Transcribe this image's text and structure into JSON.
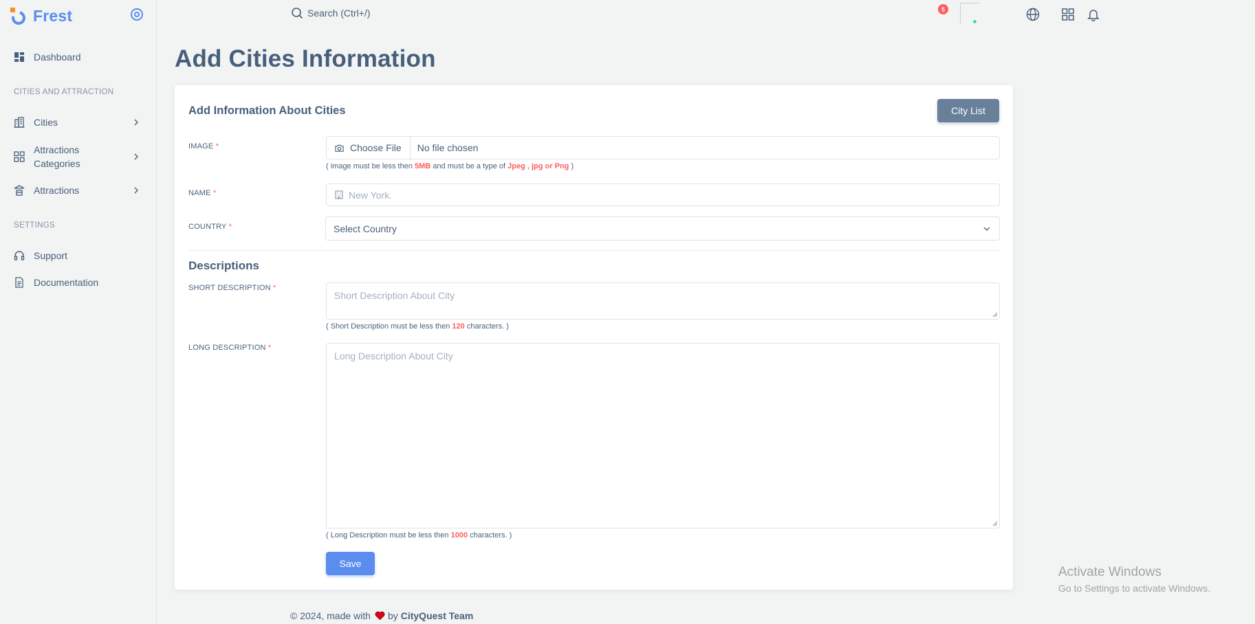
{
  "brand": {
    "name": "Frest"
  },
  "sidebar": {
    "dashboard": "Dashboard",
    "section_cities": "CITIES AND ATTRACTION",
    "cities": "Cities",
    "attr_categories_1": "Attractions",
    "attr_categories_2": "Categories",
    "attractions": "Attractions",
    "section_settings": "SETTINGS",
    "support": "Support",
    "documentation": "Documentation"
  },
  "topbar": {
    "search_placeholder": "Search (Ctrl+/)",
    "notification_count": "5"
  },
  "page": {
    "title": "Add Cities Information"
  },
  "card": {
    "title": "Add Information About Cities",
    "city_list_button": "City List"
  },
  "form": {
    "image_label": "IMAGE",
    "required_mark": "*",
    "choose_file": "Choose File",
    "file_status": "No file chosen",
    "image_hint_pre": "( image must be less then ",
    "image_hint_size": "5MB",
    "image_hint_mid": " and must be a type of ",
    "image_hint_types": "Jpeg , jpg or Png",
    "image_hint_post": " )",
    "name_label": "NAME",
    "name_placeholder": "New York.",
    "country_label": "COUNTRY",
    "country_value": "Select Country",
    "descriptions_title": "Descriptions",
    "short_label": "SHORT DESCRIPTION",
    "short_placeholder": "Short Description About City",
    "short_hint_pre": "( Short Description must be less then ",
    "short_hint_count": "120",
    "short_hint_post": " characters. )",
    "long_label": "LONG DESCRIPTION",
    "long_placeholder": "Long Description About City",
    "long_hint_pre": "( Long Description must be less then ",
    "long_hint_count": "1000",
    "long_hint_post": " characters. )",
    "save_button": "Save"
  },
  "footer": {
    "copyright": "© 2024, made with",
    "by": "by",
    "team": "CityQuest Team"
  },
  "watermark": {
    "line1": "Activate Windows",
    "line2": "Go to Settings to activate Windows."
  },
  "colors": {
    "primary": "#5a8dee",
    "secondary": "#69809a",
    "danger": "#ff5b5c",
    "text": "#475f7b",
    "online": "#39da8a"
  }
}
